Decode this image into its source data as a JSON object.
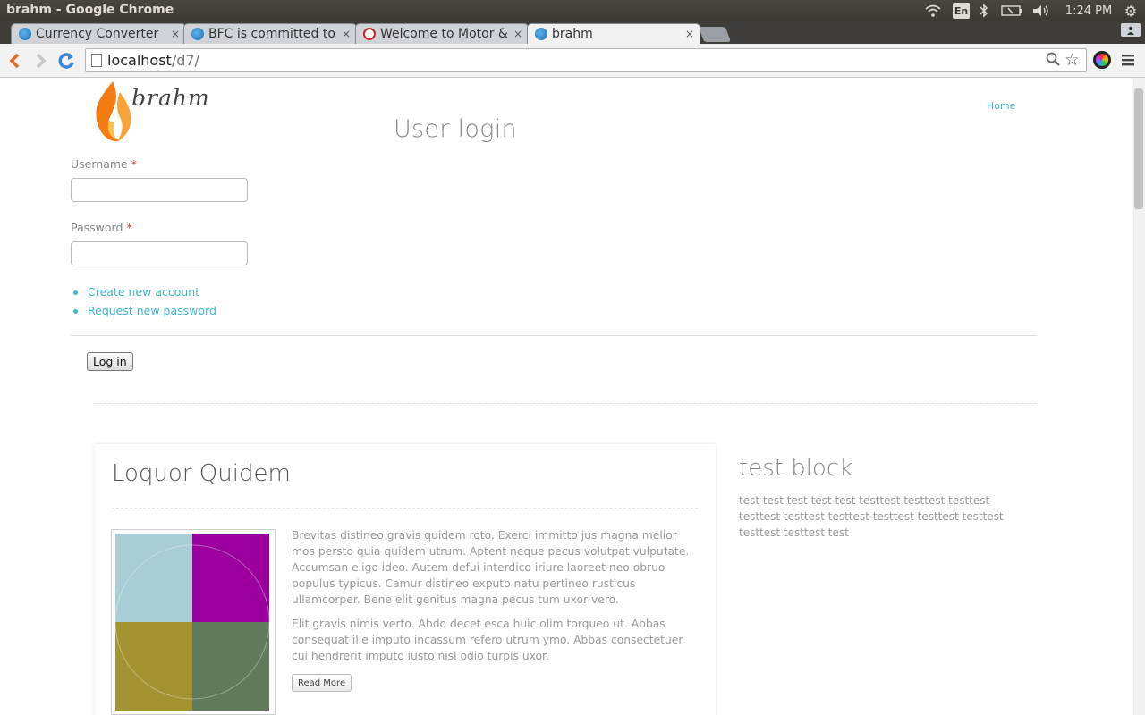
{
  "window": {
    "title": "brahm - Google Chrome"
  },
  "tray": {
    "language": "En",
    "clock": "1:24 PM",
    "icons": [
      "wifi-icon",
      "bluetooth-icon",
      "battery-icon",
      "volume-icon",
      "settings-gear-icon"
    ]
  },
  "tabs": [
    {
      "title": "Currency Converter",
      "favicon": "drupal-icon",
      "active": false
    },
    {
      "title": "BFC is committed to",
      "favicon": "drupal-icon",
      "active": false
    },
    {
      "title": "Welcome to Motor &",
      "favicon": "motor-icon",
      "active": false
    },
    {
      "title": "brahm",
      "favicon": "drupal-icon",
      "active": true
    }
  ],
  "tab_close_glyph": "×",
  "address_bar": {
    "host": "localhost",
    "path": "/d7/"
  },
  "page": {
    "logo_text": "brahm",
    "nav": {
      "home": "Home"
    },
    "login": {
      "title": "User login",
      "username_label": "Username",
      "password_label": "Password",
      "required_marker": "*",
      "username_value": "",
      "password_value": "",
      "links": {
        "create_account": "Create new account",
        "request_password": "Request new password"
      },
      "submit": "Log in"
    },
    "article": {
      "title": "Loquor Quidem",
      "paragraphs": [
        "Brevitas distineo gravis quidem roto. Exerci immitto jus magna melior mos persto quia quidem utrum. Aptent neque pecus volutpat vulputate. Accumsan eligo ideo. Autem defui interdico iriure laoreet neo obruo populus typicus. Camur distineo exputo natu pertineo rusticus ullamcorper. Bene elit genitus magna pecus tum uxor vero.",
        "Elit gravis nimis verto. Abdo decet esca huic olim torqueo ut. Abbas consequat ille imputo incassum refero utrum ymo. Abbas consectetuer cui hendrerit imputo iusto nisl odio turpis uxor."
      ],
      "read_more": "Read More",
      "image_colors": [
        "#a9cdd5",
        "#9b009e",
        "#a39431",
        "#617a5c"
      ]
    },
    "block": {
      "title": "test block",
      "body": "test test test test test testtest testtest testtest testtest testtest testtest testtest testtest testtest testtest testtest test"
    }
  },
  "colors": {
    "link": "#3fb6c9",
    "required": "#cc4444",
    "flame_orange": "#f47a12"
  }
}
